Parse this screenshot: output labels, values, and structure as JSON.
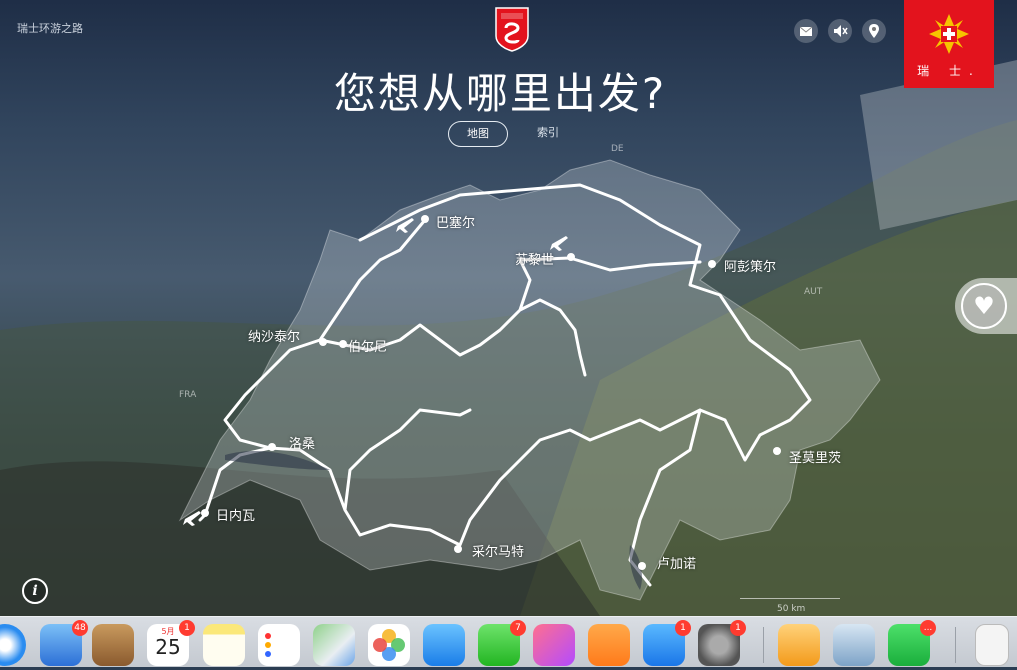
{
  "header": {
    "site_title": "瑞士环游之路",
    "headline": "您想从哪里出发?",
    "tabs": [
      {
        "label": "地图",
        "active": true
      },
      {
        "label": "索引",
        "active": false
      }
    ],
    "badge_text": "瑞 士."
  },
  "icons": {
    "mail": "mail-icon",
    "mute": "speaker-muted-icon",
    "location": "location-pin-icon",
    "favorite": "heart-icon",
    "info": "info-icon"
  },
  "map": {
    "countries": {
      "de": "DE",
      "aut": "AUT",
      "fra": "FRA"
    },
    "cities": [
      {
        "name": "巴塞尔",
        "airport": true
      },
      {
        "name": "苏黎世",
        "airport": true
      },
      {
        "name": "阿彭策尔",
        "airport": false
      },
      {
        "name": "纳沙泰尔",
        "airport": false
      },
      {
        "name": "伯尔尼",
        "airport": false
      },
      {
        "name": "洛桑",
        "airport": false
      },
      {
        "name": "日内瓦",
        "airport": true
      },
      {
        "name": "采尔马特",
        "airport": false
      },
      {
        "name": "圣莫里茨",
        "airport": false
      },
      {
        "name": "卢加诺",
        "airport": false
      }
    ],
    "scale_label": "50 km"
  },
  "dock": {
    "items": [
      {
        "name": "safari",
        "badge": ""
      },
      {
        "name": "mail",
        "badge": "48"
      },
      {
        "name": "contacts",
        "badge": ""
      },
      {
        "name": "calendar",
        "badge": "1",
        "month": "5月",
        "day": "25"
      },
      {
        "name": "notes",
        "badge": ""
      },
      {
        "name": "reminders",
        "badge": ""
      },
      {
        "name": "maps",
        "badge": ""
      },
      {
        "name": "photos",
        "badge": ""
      },
      {
        "name": "messages",
        "badge": ""
      },
      {
        "name": "facetime",
        "badge": "7"
      },
      {
        "name": "music",
        "badge": ""
      },
      {
        "name": "books",
        "badge": ""
      },
      {
        "name": "app-store",
        "badge": "1"
      },
      {
        "name": "system-preferences",
        "badge": "1"
      },
      {
        "name": "pages",
        "badge": ""
      },
      {
        "name": "preview",
        "badge": ""
      },
      {
        "name": "wechat",
        "badge": "..."
      },
      {
        "name": "document",
        "badge": ""
      }
    ]
  }
}
